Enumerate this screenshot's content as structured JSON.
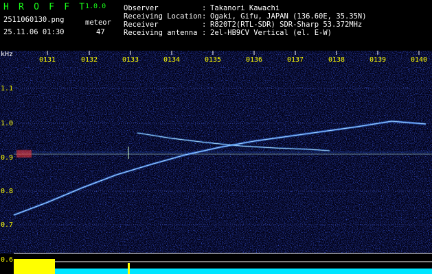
{
  "app": {
    "name": "H R O F F T",
    "version": "1.0.0"
  },
  "file": {
    "name": "2511060130.png",
    "timestamp": "25.11.06 01:30"
  },
  "meteor": {
    "label": "meteor",
    "count": "47"
  },
  "station": [
    {
      "label": "Observer",
      "value": "Takanori Kawachi"
    },
    {
      "label": "Receiving Location",
      "value": "Ogaki, Gifu, JAPAN (136.60E, 35.35N)"
    },
    {
      "label": "Receiver",
      "value": "R820T2(RTL-SDR) SDR-Sharp 53.372MHz"
    },
    {
      "label": "Receiving antenna",
      "value": "2el-HB9CV Vertical (el. E-W)"
    }
  ],
  "separator": ":",
  "axis": {
    "unit": "kHz",
    "y_ticks": [
      "1.1",
      "1.0",
      "0.9",
      "0.8",
      "0.7",
      "0.6"
    ],
    "time_ticks": [
      "0131",
      "0132",
      "0133",
      "0134",
      "0135",
      "0136",
      "0137",
      "0138",
      "0139",
      "0140"
    ]
  },
  "colors": {
    "header_text": "#ffffff",
    "brand": "#19ff19",
    "axis_text": "#ffff00",
    "background_noise": "#0a0a5a",
    "baseline_trace": "#00ffff",
    "meteor_trace": "#66aaff",
    "level_bar": "#00e5ff",
    "level_peak": "#ffff00"
  }
}
